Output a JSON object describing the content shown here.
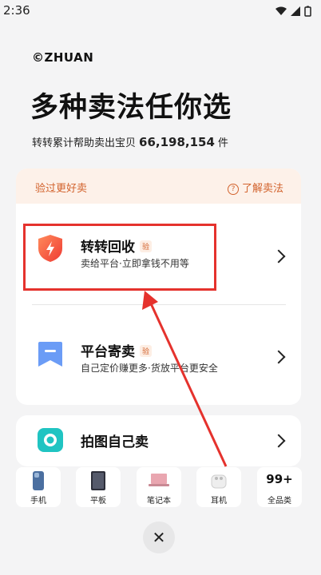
{
  "status_bar": {
    "time": "2:36"
  },
  "header": {
    "brand": "©ZHUAN",
    "headline": "多种卖法任你选",
    "sub_prefix": "转转累计帮助卖出宝贝",
    "sub_count": "66,198,154",
    "sub_suffix": "件"
  },
  "card": {
    "head_left": "验过更好卖",
    "head_right": "了解卖法",
    "options": [
      {
        "title": "转转回收",
        "badge": "验",
        "desc": "卖给平台·立即拿钱不用等"
      },
      {
        "title": "平台寄卖",
        "badge": "验",
        "desc": "自己定价赚更多·货放平台更安全"
      }
    ]
  },
  "self_sell": {
    "title": "拍图自己卖"
  },
  "categories": [
    {
      "label": "手机"
    },
    {
      "label": "平板"
    },
    {
      "label": "笔记本"
    },
    {
      "label": "耳机"
    },
    {
      "label": "全品类",
      "count": "99+"
    }
  ],
  "colors": {
    "accent": "#d2622c",
    "highlight": "#e5322d",
    "teal": "#1ec2c2",
    "blue": "#5a8ef3"
  }
}
